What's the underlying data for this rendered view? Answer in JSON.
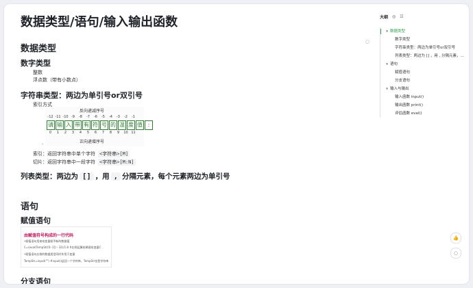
{
  "doc": {
    "title": "数据类型/语句/输入输出函数",
    "sec_datatypes": "数据类型",
    "numeric_heading": "数字类型",
    "numeric_items": [
      "整数",
      "浮点数（带有小数点）"
    ],
    "string_heading": "字符串类型：两边为单引号or双引号",
    "index_method": "索引方式",
    "index_diagram": {
      "reverse_label": "反向递减序号",
      "forward_label": "正向递增序号",
      "neg_indices": [
        "-12",
        "-11",
        "-10",
        "-9",
        "-8",
        "-7",
        "-6",
        "-5",
        "-4",
        "-3",
        "-2",
        "-1"
      ],
      "chars": [
        "请",
        "输",
        "入",
        "带",
        "有",
        "符",
        "号",
        "的",
        "温",
        "度",
        "值",
        ":"
      ],
      "pos_indices": [
        "0",
        "1",
        "2",
        "3",
        "4",
        "5",
        "6",
        "7",
        "8",
        "9",
        "10",
        "11"
      ]
    },
    "dot": ".",
    "index_note": "索引：返回字符串中单个字符",
    "index_syntax": "<字符串>[M]",
    "slice_note": "切片：返回字符串中一段字符",
    "slice_syntax": "<字符串>[M:N]",
    "list_heading_a": "列表类型：两边为",
    "list_bracket": "[]",
    "list_heading_b": "，用",
    "list_comma": ",",
    "list_heading_c": "分隔元素，每个元素两边为单引号",
    "sec_statements": "语句",
    "assign_heading": "赋值语句",
    "assign_image": {
      "title": "由赋值符号构成的一行代码",
      "lines": [
        "•赋值语句用来给变量赋予新的数据值",
        "C=(eval(TempStr[0:-1]) - 32)/1.8 #右侧运算结果赋给变量C",
        "•赋值语句右侧的数据类型同时作用于变量",
        "TempStr=input(\"\") #input()返回一个字符串，TempStr也是字符串"
      ]
    },
    "branch_heading": "分支语句"
  },
  "outline": {
    "title": "大纲",
    "items": [
      {
        "label": "数据类型",
        "level": 0,
        "caret": "▼"
      },
      {
        "label": "数字类型",
        "level": 1,
        "caret": ""
      },
      {
        "label": "字符串类型：两边为单引号or双引号",
        "level": 1,
        "caret": ""
      },
      {
        "label": "列表类型：两边为 [] ，用 , 分隔元素，每个元素两边为单引号",
        "level": 1,
        "caret": ""
      },
      {
        "label": "语句",
        "level": 0,
        "caret": "▼"
      },
      {
        "label": "赋值语句",
        "level": 1,
        "caret": ""
      },
      {
        "label": "分支语句",
        "level": 1,
        "caret": ""
      },
      {
        "label": "输入与输出",
        "level": 0,
        "caret": "▼"
      },
      {
        "label": "输入函数 input()",
        "level": 1,
        "caret": ""
      },
      {
        "label": "输出函数 print()",
        "level": 1,
        "caret": ""
      },
      {
        "label": "评估函数 eval()",
        "level": 1,
        "caret": ""
      }
    ]
  },
  "icons": {
    "outline_eye": "◎",
    "outline_list": "☷",
    "comment": "◌",
    "like": "👍",
    "chat": "◌"
  },
  "colors": {
    "accent": "#2e9e4f",
    "diagram_green": "#2e7d32",
    "image_title": "#c2185b"
  }
}
